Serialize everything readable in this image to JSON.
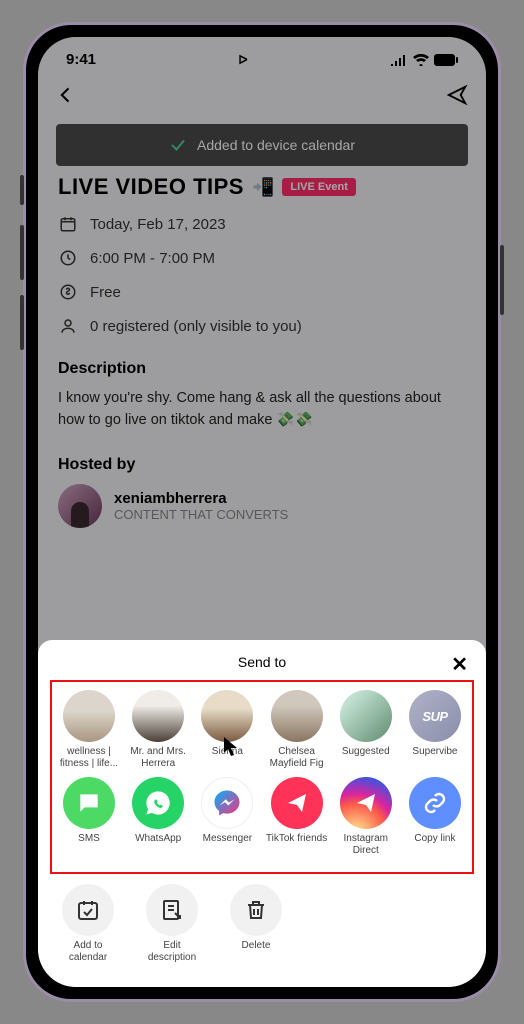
{
  "status": {
    "time": "9:41"
  },
  "toast": {
    "message": "Added to device calendar"
  },
  "event": {
    "title": "LIVE VIDEO TIPS",
    "badge": "LIVE Event",
    "date": "Today, Feb 17, 2023",
    "time": "6:00 PM - 7:00 PM",
    "price": "Free",
    "registered": "0 registered (only visible to you)",
    "description_heading": "Description",
    "description": "I know you're shy. Come hang & ask all the questions about how to go live on tiktok and make 💸💸",
    "hosted_heading": "Hosted by",
    "host_name": "xeniambherrera",
    "host_sub": "CONTENT THAT CONVERTS"
  },
  "sheet": {
    "title": "Send to",
    "contacts": [
      {
        "label": "wellness | fitness | life..."
      },
      {
        "label": "Mr. and Mrs. Herrera"
      },
      {
        "label": "Sienna"
      },
      {
        "label": "Chelsea Mayfield Fig"
      },
      {
        "label": "Suggested"
      },
      {
        "label": "Supervibe"
      }
    ],
    "apps": [
      {
        "label": "SMS"
      },
      {
        "label": "WhatsApp"
      },
      {
        "label": "Messenger"
      },
      {
        "label": "TikTok friends"
      },
      {
        "label": "Instagram Direct"
      },
      {
        "label": "Copy link"
      }
    ],
    "actions": [
      {
        "label": "Add to calendar"
      },
      {
        "label": "Edit description"
      },
      {
        "label": "Delete"
      }
    ]
  }
}
